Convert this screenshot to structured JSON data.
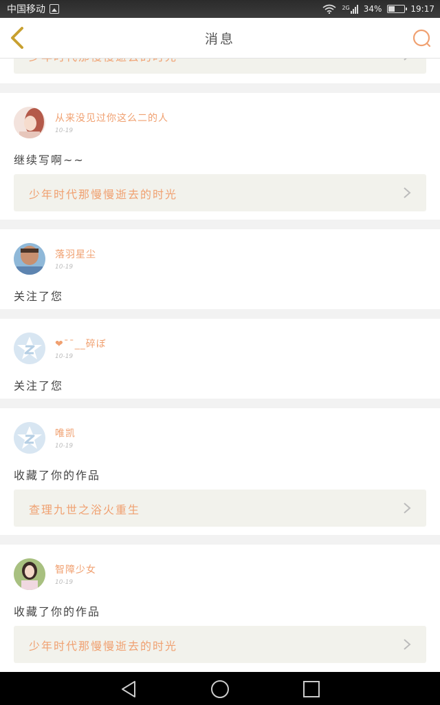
{
  "status_bar": {
    "carrier": "中国移动",
    "network": "2G",
    "battery": "34%",
    "time": "19:17"
  },
  "header": {
    "title": "消息",
    "back_icon": "chevron-left-icon",
    "search_icon": "search-icon"
  },
  "colors": {
    "accent": "#f0a070",
    "back_icon": "#c8a030",
    "work_bg": "#f2f2ec",
    "page_bg": "#f2f2f2"
  },
  "partial_work_card": {
    "title": "少年时代那慢慢逝去的时光"
  },
  "messages": [
    {
      "user": "从来没见过你这么二的人",
      "time": "10-19",
      "text": "继续写啊~~",
      "avatar": "photo-avatar",
      "work": "少年时代那慢慢逝去的时光"
    },
    {
      "user": "落羽星尘",
      "time": "10-19",
      "text": "关注了您",
      "avatar": "photo-avatar"
    },
    {
      "user": "❤¯¯__碎ぼ",
      "time": "10-19",
      "text": "关注了您",
      "avatar": "default-star-avatar"
    },
    {
      "user": "唯凯",
      "time": "10-19",
      "text": "收藏了你的作品",
      "avatar": "default-star-avatar",
      "work": "查理九世之浴火重生"
    },
    {
      "user": "智障少女",
      "time": "10-19",
      "text": "收藏了你的作品",
      "avatar": "photo-avatar",
      "work": "少年时代那慢慢逝去的时光"
    }
  ],
  "nav_bar": {
    "back_icon": "triangle-back-icon",
    "home_icon": "circle-home-icon",
    "recents_icon": "square-recents-icon"
  }
}
